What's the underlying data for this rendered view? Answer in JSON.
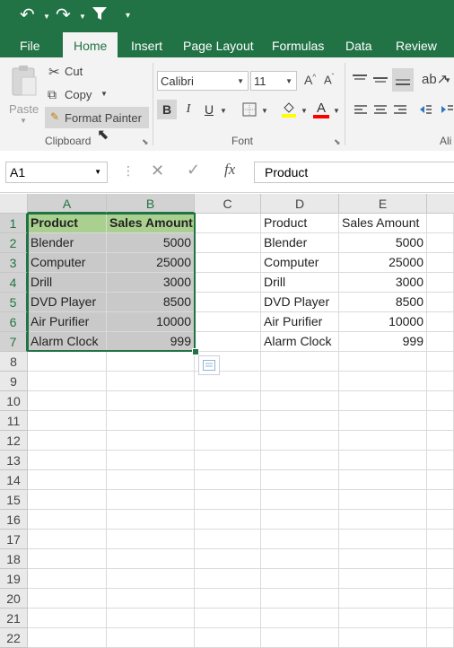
{
  "ribbon_tabs": [
    "File",
    "Home",
    "Insert",
    "Page Layout",
    "Formulas",
    "Data",
    "Review"
  ],
  "active_tab": "Home",
  "clipboard": {
    "paste_label": "Paste",
    "cut_label": "Cut",
    "copy_label": "Copy",
    "format_painter_label": "Format Painter",
    "group_label": "Clipboard"
  },
  "font": {
    "font_name": "Calibri",
    "font_size": "11",
    "bold_label": "B",
    "italic_label": "I",
    "underline_label": "U",
    "font_color_label": "A",
    "group_label": "Font"
  },
  "alignment": {
    "group_label_partial": "Ali"
  },
  "formula_bar": {
    "name_box": "A1",
    "fx_label": "fx",
    "content": "Product"
  },
  "columns": [
    "A",
    "B",
    "C",
    "D",
    "E"
  ],
  "rows": [
    "1",
    "2",
    "3",
    "4",
    "5",
    "6",
    "7",
    "8",
    "9",
    "10",
    "11",
    "12",
    "13",
    "14",
    "15",
    "16",
    "17",
    "18",
    "19",
    "20",
    "21",
    "22"
  ],
  "table_header": {
    "product": "Product",
    "sales": "Sales Amount"
  },
  "table_rows": [
    {
      "product": "Blender",
      "sales": "5000"
    },
    {
      "product": "Computer",
      "sales": "25000"
    },
    {
      "product": "Drill",
      "sales": "3000"
    },
    {
      "product": "DVD Player",
      "sales": "8500"
    },
    {
      "product": "Air Purifier",
      "sales": "10000"
    },
    {
      "product": "Alarm Clock",
      "sales": "999"
    }
  ],
  "colors": {
    "excel_green": "#217346",
    "header_fill": "#a9d08e",
    "selection_fill": "#c9c9c9"
  }
}
